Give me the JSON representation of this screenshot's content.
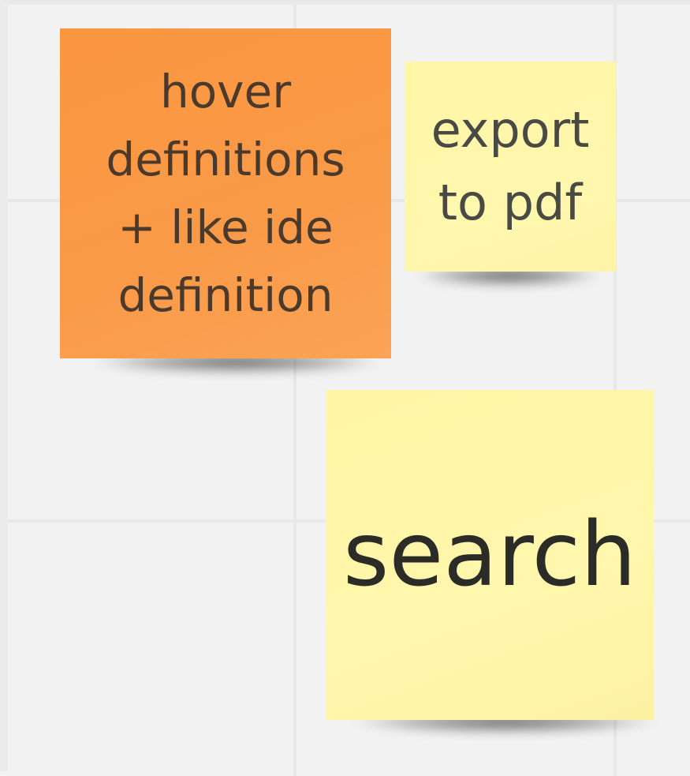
{
  "board": {
    "notes": [
      {
        "text": "hover\ndefinitions\n+ like ide\ndefinition",
        "color": "#f99a48"
      },
      {
        "text": "export\nto pdf",
        "color": "#fff7ae"
      },
      {
        "text": "search",
        "color": "#fff7ad"
      }
    ]
  }
}
